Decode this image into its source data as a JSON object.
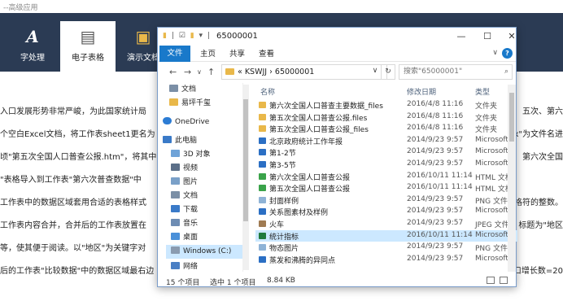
{
  "background": {
    "title_fragment": "--高级应用",
    "tabs": [
      {
        "label": "字处理",
        "icon": "A"
      },
      {
        "label": "电子表格",
        "icon": "▤"
      },
      {
        "label": "演示文档",
        "icon": "▣"
      }
    ],
    "lines": [
      "入口发展形势非常严峻，为此国家统计局",
      "个空白Excel文档，将工作表sheet1更名为",
      "顷\"第五次全国人口普查公报.htm\"，将其中",
      "\"表格导入到工作表\"第六次普查数据\"中",
      "工作表中的数据区域套用合适的表格样式",
      "工作表内容合并，合并后的工作表放置在",
      "等，使其便于阅读。以\"地区\"为关键字对",
      "后的工作表\"比较数据\"中的数据区域最右边"
    ],
    "right_fragments": [
      "五次、第六",
      "x\"为文件名进",
      "第六次全国",
      "",
      "格符的整数。",
      "标题为\"地区",
      "",
      "口增长数=20"
    ]
  },
  "window": {
    "title": "65000001",
    "ribbon_tabs": [
      "文件",
      "主页",
      "共享",
      "查看"
    ],
    "nav_back": "←",
    "nav_forward": "→",
    "nav_recent": "∨",
    "nav_up": "↑",
    "breadcrumb": "«  KSWJJ  ›  65000001",
    "refresh": "↻",
    "dropdown": "∨",
    "search_placeholder": "搜索\"65000001\"",
    "nav_items": [
      {
        "label": "文档",
        "color": "#7b8fa6"
      },
      {
        "label": "易坪千玺",
        "color": "#e9b84a"
      },
      {
        "label": "OneDrive",
        "color": "#2c7cd4"
      },
      {
        "label": "此电脑",
        "color": "#3a7ac8"
      },
      {
        "label": "3D 对象",
        "color": "#6fa3d8"
      },
      {
        "label": "视频",
        "color": "#5b6f88"
      },
      {
        "label": "图片",
        "color": "#7aa0c8"
      },
      {
        "label": "文档",
        "color": "#7b8fa6"
      },
      {
        "label": "下载",
        "color": "#3a7ac8"
      },
      {
        "label": "音乐",
        "color": "#6d8cb3"
      },
      {
        "label": "桌面",
        "color": "#4a90d9"
      },
      {
        "label": "Windows (C:)",
        "color": "#8a9bb0"
      },
      {
        "label": "网络",
        "color": "#4a7fc4"
      }
    ],
    "columns": {
      "name": "名称",
      "date": "修改日期",
      "type": "类型"
    },
    "files": [
      {
        "name": "第六次全国人口普查主要数据_files",
        "date": "2016/4/8 11:16",
        "type": "文件夹",
        "color": "#e9b84a"
      },
      {
        "name": "第五次全国人口普查公报.files",
        "date": "2016/4/8 11:16",
        "type": "文件夹",
        "color": "#e9b84a"
      },
      {
        "name": "第五次全国人口普查公报_files",
        "date": "2016/4/8 11:16",
        "type": "文件夹",
        "color": "#e9b84a"
      },
      {
        "name": "北京政府统计工作年报",
        "date": "2014/9/23 9:57",
        "type": "Microsoft",
        "color": "#2b6fc4"
      },
      {
        "name": "第1-2节",
        "date": "2014/9/23 9:57",
        "type": "Microsoft",
        "color": "#2b6fc4"
      },
      {
        "name": "第3-5节",
        "date": "2014/9/23 9:57",
        "type": "Microsoft",
        "color": "#2b6fc4"
      },
      {
        "name": "第六次全国人口普查公报",
        "date": "2016/10/11 11:14",
        "type": "HTML 文档",
        "color": "#3aa34a"
      },
      {
        "name": "第五次全国人口普查公报",
        "date": "2016/10/11 11:14",
        "type": "HTML 文档",
        "color": "#3aa34a"
      },
      {
        "name": "封面样例",
        "date": "2014/9/23 9:57",
        "type": "PNG 文件",
        "color": "#8fb3d6"
      },
      {
        "name": "关系图素材及样例",
        "date": "2014/9/23 9:57",
        "type": "Microsoft",
        "color": "#2b6fc4"
      },
      {
        "name": "火车",
        "date": "2014/9/23 9:57",
        "type": "JPEG 文件",
        "color": "#a07b52"
      },
      {
        "name": "统计指标",
        "date": "2016/10/11 11:14",
        "type": "Microsoft",
        "color": "#1f7a3c"
      },
      {
        "name": "物态图片",
        "date": "2014/9/23 9:57",
        "type": "PNG 文件",
        "color": "#8fb3d6"
      },
      {
        "name": "蒸发和沸腾的异同点",
        "date": "2014/9/23 9:57",
        "type": "Microsoft",
        "color": "#2b6fc4"
      }
    ],
    "status_count": "15 个项目",
    "status_selected": "选中 1 个项目",
    "status_size": "8.84 KB"
  }
}
